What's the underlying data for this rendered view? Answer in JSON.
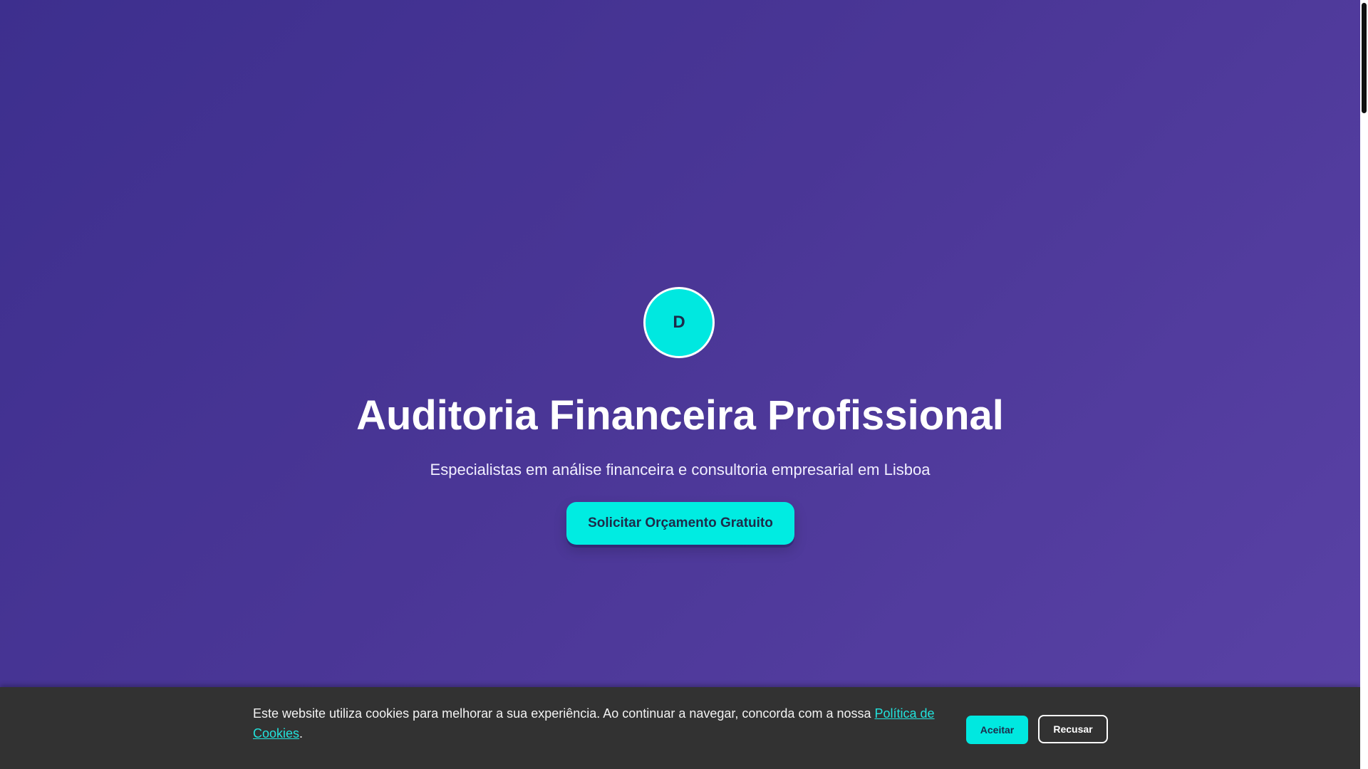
{
  "hero": {
    "logo_letter": "D",
    "title": "Auditoria Financeira Profissional",
    "subtitle": "Especialistas em análise financeira e consultoria empresarial em Lisboa",
    "cta_label": "Solicitar Orçamento Gratuito"
  },
  "cookie_banner": {
    "text": "Este website utiliza cookies para melhorar a sua experiência. Ao continuar a navegar, concorda com a nossa ",
    "link_label": "Política de Cookies",
    "text_end": ".",
    "accept_label": "Aceitar",
    "decline_label": "Recusar"
  },
  "colors": {
    "hero_gradient_start": "#3d2f8e",
    "hero_gradient_end": "#5a42a6",
    "accent": "#00e8e0",
    "cookie_bar_bg": "#323232",
    "link": "#22e2dc"
  }
}
